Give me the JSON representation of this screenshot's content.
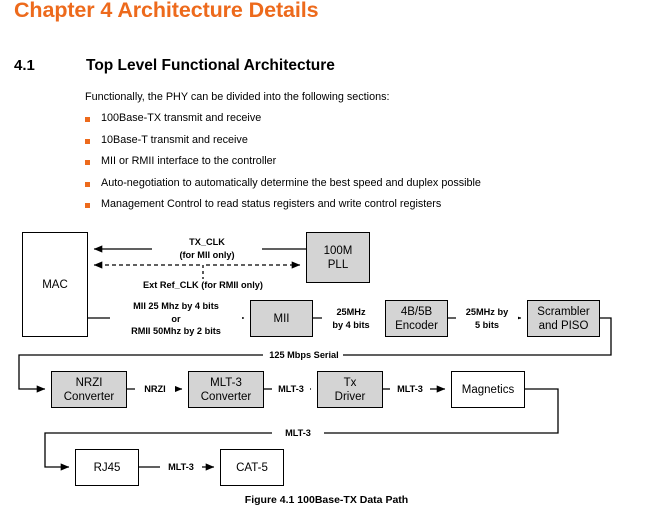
{
  "document": {
    "chapter_title": "Chapter 4 Architecture Details",
    "accent_color": "#ED6A1C",
    "section": {
      "number": "4.1",
      "heading": "Top Level Functional Architecture"
    },
    "intro_paragraph": "Functionally, the PHY can be divided into the following sections:",
    "bullets": [
      "100Base-TX transmit and receive",
      "10Base-T transmit and receive",
      "MII or RMII interface to the controller",
      "Auto-negotiation to automatically determine the best speed and duplex possible",
      "Management Control to read status registers and write control registers"
    ]
  },
  "figure": {
    "caption": "Figure 4.1 100Base-TX Data Path",
    "blocks": {
      "mac": "MAC",
      "pll_line1": "100M",
      "pll_line2": "PLL",
      "mii": "MII",
      "encoder_line1": "4B/5B",
      "encoder_line2": "Encoder",
      "scrambler_line1": "Scrambler",
      "scrambler_line2": "and PISO",
      "nrzi_line1": "NRZI",
      "nrzi_line2": "Converter",
      "mlt3_line1": "MLT-3",
      "mlt3_line2": "Converter",
      "txdriver_line1": "Tx",
      "txdriver_line2": "Driver",
      "magnetics": "Magnetics",
      "rj45": "RJ45",
      "cat5": "CAT-5"
    },
    "signals": {
      "tx_clk_line1": "TX_CLK",
      "tx_clk_line2": "(for MII only)",
      "ext_ref_clk": "Ext Ref_CLK (for RMII only)",
      "mii_rate_line1": "MII 25 Mhz by 4 bits",
      "mii_rate_line2": "or",
      "mii_rate_line3": "RMII 50Mhz by 2 bits",
      "enc_in_line1": "25MHz",
      "enc_in_line2": "by 4 bits",
      "enc_out_line1": "25MHz by",
      "enc_out_line2": "5 bits",
      "serial_125": "125 Mbps Serial",
      "nrzi_sig": "NRZI",
      "mlt3_sig_a": "MLT-3",
      "mlt3_sig_b": "MLT-3",
      "mlt3_sig_c": "MLT-3",
      "mlt3_sig_d": "MLT-3"
    }
  }
}
